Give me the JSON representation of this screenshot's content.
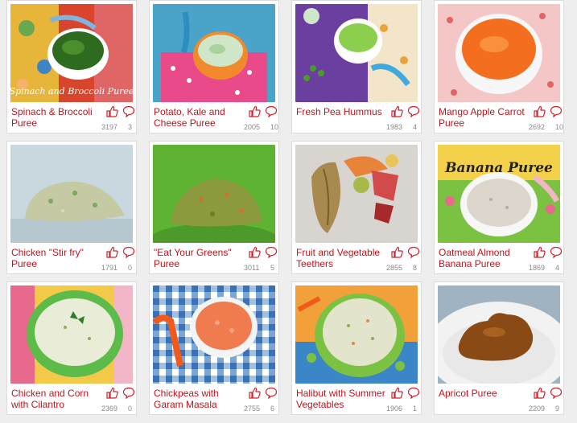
{
  "cards": [
    {
      "title": "Spinach & Broccoli Puree",
      "likes": "3197",
      "comments": "3",
      "image_caption": "Spinach and Broccoli Puree"
    },
    {
      "title": "Potato, Kale and Cheese Puree",
      "likes": "2005",
      "comments": "10"
    },
    {
      "title": "Fresh Pea Hummus",
      "likes": "1983",
      "comments": "4"
    },
    {
      "title": "Mango Apple Carrot Puree",
      "likes": "2692",
      "comments": "10"
    },
    {
      "title": "Chicken \"Stir fry\" Puree",
      "likes": "1791",
      "comments": "0"
    },
    {
      "title": "\"Eat Your Greens\" Puree",
      "likes": "3011",
      "comments": "5"
    },
    {
      "title": "Fruit and Vegetable Teethers",
      "likes": "2855",
      "comments": "8"
    },
    {
      "title": "Oatmeal Almond Banana Puree",
      "likes": "1869",
      "comments": "4",
      "image_caption": "Banana Puree"
    },
    {
      "title": "Chicken and Corn with Cilantro",
      "likes": "2369",
      "comments": "0"
    },
    {
      "title": "Chickpeas with Garam Masala",
      "likes": "2755",
      "comments": "6"
    },
    {
      "title": "Halibut with Summer Vegetables",
      "likes": "1906",
      "comments": "1"
    },
    {
      "title": "Apricot Puree",
      "likes": "2209",
      "comments": "9"
    }
  ],
  "colors": {
    "title_text": "#c0141c",
    "icon": "#d0202a",
    "count_text": "#888888",
    "card_border": "#dcdcdc",
    "page_background": "#eeeeee"
  },
  "icons": {
    "like": "thumbs-up-icon",
    "comment": "speech-bubble-icon"
  }
}
